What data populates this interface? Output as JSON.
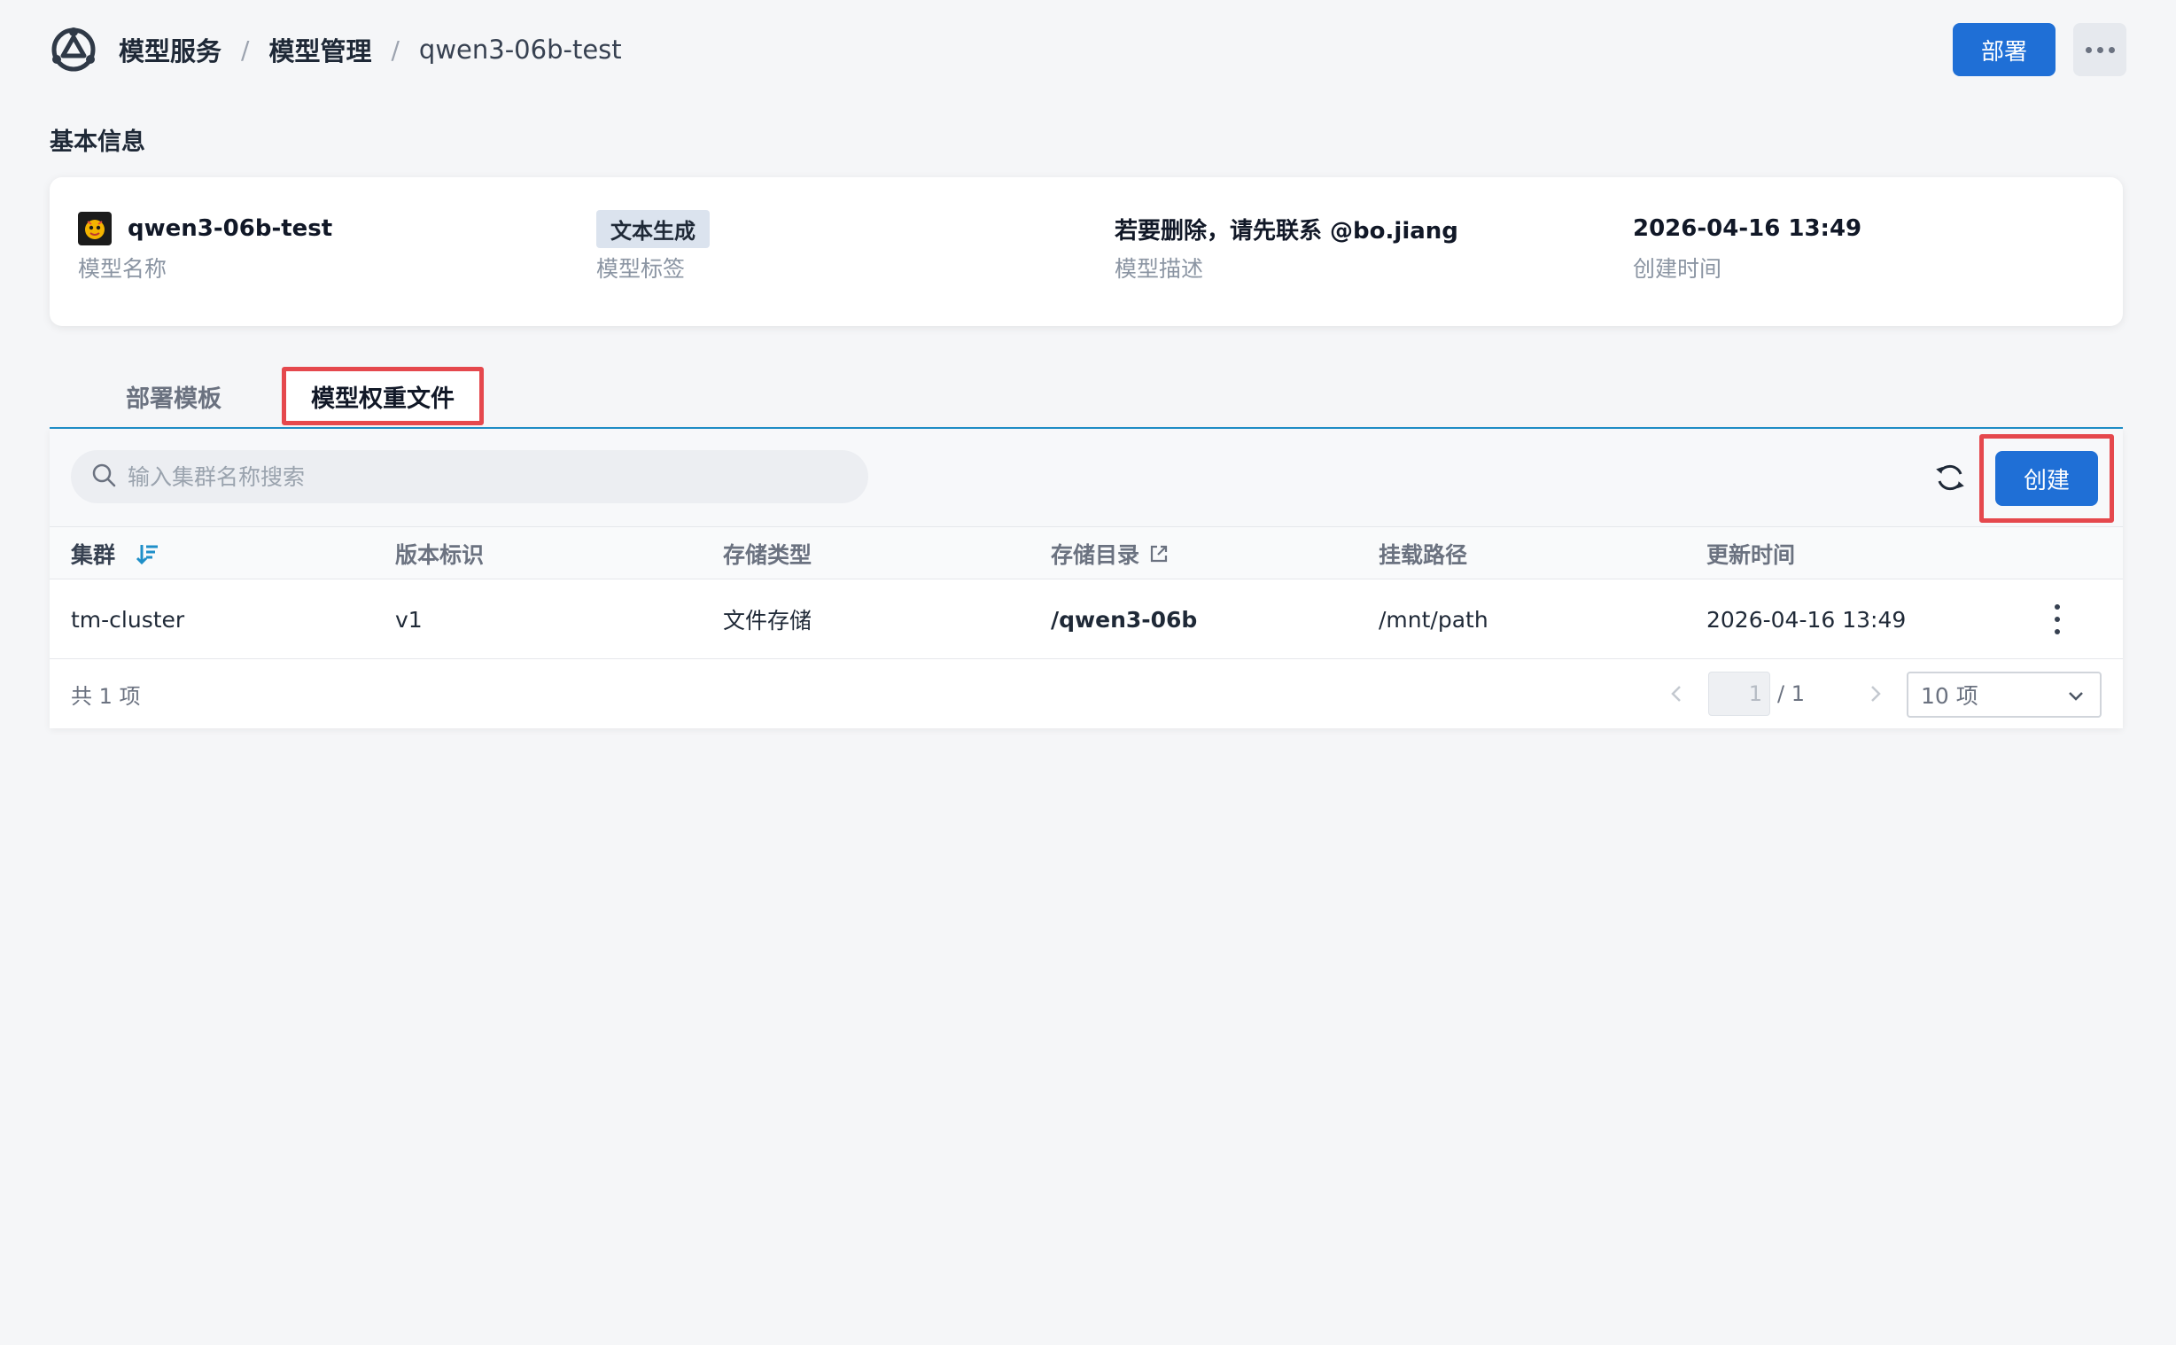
{
  "breadcrumb": [
    "模型服务",
    "模型管理",
    "qwen3-06b-test"
  ],
  "header": {
    "deploy_label": "部署"
  },
  "basic_info": {
    "title": "基本信息",
    "items": [
      {
        "value": "qwen3-06b-test",
        "label": "模型名称"
      },
      {
        "value": "文本生成",
        "label": "模型标签"
      },
      {
        "value": "若要删除，请先联系 @bo.jiang",
        "label": "模型描述"
      },
      {
        "value": "2026-04-16 13:49",
        "label": "创建时间"
      }
    ]
  },
  "tabs": [
    "部署模板",
    "模型权重文件"
  ],
  "active_tab": "模型权重文件",
  "toolbar": {
    "search_placeholder": "输入集群名称搜索",
    "create_label": "创建"
  },
  "table": {
    "columns": [
      "集群",
      "版本标识",
      "存储类型",
      "存储目录",
      "挂载路径",
      "更新时间"
    ],
    "rows": [
      {
        "cluster": "tm-cluster",
        "version": "v1",
        "storage_type": "文件存储",
        "storage_dir": "/qwen3-06b",
        "mount_path": "/mnt/path",
        "updated": "2026-04-16 13:49"
      }
    ]
  },
  "pagination": {
    "total": "共 1 项",
    "current_page": "1",
    "total_pages": "/ 1",
    "page_size": "10 项"
  },
  "colors": {
    "primary": "#1f6fd6",
    "highlight_border": "#e5484d",
    "tab_underline": "#1f8fc8"
  }
}
